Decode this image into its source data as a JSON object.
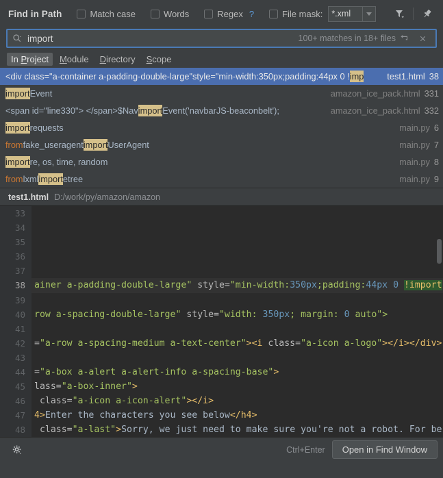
{
  "toolbar": {
    "title": "Find in Path",
    "options": [
      {
        "label": "Match case",
        "checked": false
      },
      {
        "label": "Words",
        "checked": false
      },
      {
        "label": "Regex",
        "checked": false,
        "help": "?"
      },
      {
        "label": "File mask:",
        "checked": false
      }
    ],
    "file_mask_value": "*.xml",
    "filter_icon": "filter-icon",
    "pin_icon": "pin-icon"
  },
  "search": {
    "icon": "search-icon",
    "value": "import",
    "placeholder": "Search",
    "match_info": "100+ matches in 18+ files",
    "history_icon": "history-icon",
    "clear_icon": "close-icon"
  },
  "scopes": {
    "items": [
      {
        "label": "In Project",
        "active": true
      },
      {
        "label": "Module",
        "active": false
      },
      {
        "label": "Directory",
        "active": false
      },
      {
        "label": "Scope",
        "active": false
      }
    ]
  },
  "results": {
    "rows": [
      {
        "selected": true,
        "parts": [
          {
            "t": "<div class=",
            "c": "tag"
          },
          {
            "t": "\"a-container a-padding-double-large\"",
            "c": "str"
          },
          {
            "t": " style=",
            "c": "tag"
          },
          {
            "t": "\"min-width:350px;padding:44px 0 !",
            "c": "str"
          },
          {
            "t": "imp",
            "c": "hl"
          }
        ],
        "file": "test1.html",
        "line": "38"
      },
      {
        "selected": false,
        "parts": [
          {
            "t": "import",
            "c": "hl"
          },
          {
            "t": "Event",
            "c": "def"
          }
        ],
        "file": "amazon_ice_pack.html",
        "line": "331"
      },
      {
        "selected": false,
        "parts": [
          {
            "t": "<span id=\"line330\"> </span>$Nav",
            "c": "def"
          },
          {
            "t": "import",
            "c": "hl"
          },
          {
            "t": "Event('navbarJS-beaconbelt');",
            "c": "def"
          }
        ],
        "file": "amazon_ice_pack.html",
        "line": "332"
      },
      {
        "selected": false,
        "parts": [
          {
            "t": "import",
            "c": "hl"
          },
          {
            "t": " requests",
            "c": "def"
          }
        ],
        "file": "main.py",
        "line": "6"
      },
      {
        "selected": false,
        "parts": [
          {
            "t": "from",
            "c": "kw"
          },
          {
            "t": " fake_useragent ",
            "c": "def"
          },
          {
            "t": "import",
            "c": "hl"
          },
          {
            "t": " UserAgent",
            "c": "def"
          }
        ],
        "file": "main.py",
        "line": "7"
      },
      {
        "selected": false,
        "parts": [
          {
            "t": "import",
            "c": "hl"
          },
          {
            "t": " re, os, time, random",
            "c": "def"
          }
        ],
        "file": "main.py",
        "line": "8"
      },
      {
        "selected": false,
        "parts": [
          {
            "t": "from",
            "c": "kw"
          },
          {
            "t": " lxml ",
            "c": "def"
          },
          {
            "t": "import",
            "c": "hl"
          },
          {
            "t": " etree",
            "c": "def"
          }
        ],
        "file": "main.py",
        "line": "9"
      }
    ]
  },
  "file_header": {
    "name": "test1.html",
    "path": "D:/work/py/amazon/amazon"
  },
  "editor": {
    "browser_bar": {
      "icons": [
        "reformat-icon",
        "chrome-icon",
        "firefox-icon",
        "safari-icon",
        "opera-icon",
        "internet-explorer-icon",
        "edge-icon"
      ]
    },
    "lines": [
      {
        "num": "33",
        "current": false,
        "parts": []
      },
      {
        "num": "34",
        "current": false,
        "parts": []
      },
      {
        "num": "35",
        "current": false,
        "parts": []
      },
      {
        "num": "36",
        "current": false,
        "parts": []
      },
      {
        "num": "37",
        "current": false,
        "parts": []
      },
      {
        "num": "38",
        "current": true,
        "parts": [
          {
            "t": "ainer a-padding-double-large",
            "c": "str"
          },
          {
            "t": "\" ",
            "c": "str"
          },
          {
            "t": "style=",
            "c": "attr"
          },
          {
            "t": "\"min-width:",
            "c": "str"
          },
          {
            "t": "350px",
            "c": "num"
          },
          {
            "t": ";padding:",
            "c": "str"
          },
          {
            "t": "44px",
            "c": "num"
          },
          {
            "t": " ",
            "c": "str"
          },
          {
            "t": "0",
            "c": "num"
          },
          {
            "t": " ",
            "c": "str"
          },
          {
            "t": "!import",
            "c": "green"
          }
        ]
      },
      {
        "num": "39",
        "current": false,
        "parts": []
      },
      {
        "num": "40",
        "current": false,
        "parts": [
          {
            "t": "row a-spacing-double-large",
            "c": "str"
          },
          {
            "t": "\" ",
            "c": "str"
          },
          {
            "t": "style=",
            "c": "attr"
          },
          {
            "t": "\"width: ",
            "c": "str"
          },
          {
            "t": "350px",
            "c": "num"
          },
          {
            "t": "; margin: ",
            "c": "str"
          },
          {
            "t": "0",
            "c": "num"
          },
          {
            "t": " auto\">",
            "c": "str"
          }
        ]
      },
      {
        "num": "41",
        "current": false,
        "parts": []
      },
      {
        "num": "42",
        "current": false,
        "parts": [
          {
            "t": "=",
            "c": "attr"
          },
          {
            "t": "\"a-row a-spacing-medium a-text-center\"",
            "c": "str"
          },
          {
            "t": "><i ",
            "c": "tag"
          },
          {
            "t": "class=",
            "c": "attr"
          },
          {
            "t": "\"a-icon a-logo\"",
            "c": "str"
          },
          {
            "t": "></i></div>",
            "c": "tag"
          }
        ]
      },
      {
        "num": "43",
        "current": false,
        "parts": []
      },
      {
        "num": "44",
        "current": false,
        "parts": [
          {
            "t": "=",
            "c": "attr"
          },
          {
            "t": "\"a-box a-alert a-alert-info a-spacing-base\"",
            "c": "str"
          },
          {
            "t": ">",
            "c": "tag"
          }
        ]
      },
      {
        "num": "45",
        "current": false,
        "parts": [
          {
            "t": "lass=",
            "c": "attr"
          },
          {
            "t": "\"a-box-inner\"",
            "c": "str"
          },
          {
            "t": ">",
            "c": "tag"
          }
        ]
      },
      {
        "num": "46",
        "current": false,
        "parts": [
          {
            "t": " class=",
            "c": "attr"
          },
          {
            "t": "\"a-icon a-icon-alert\"",
            "c": "str"
          },
          {
            "t": "></i>",
            "c": "tag"
          }
        ]
      },
      {
        "num": "47",
        "current": false,
        "parts": [
          {
            "t": "4>",
            "c": "tag"
          },
          {
            "t": "Enter the characters you see below",
            "c": "txt"
          },
          {
            "t": "</h4>",
            "c": "tag"
          }
        ]
      },
      {
        "num": "48",
        "current": false,
        "parts": [
          {
            "t": " class=",
            "c": "attr"
          },
          {
            "t": "\"a-last\"",
            "c": "str"
          },
          {
            "t": ">",
            "c": "tag"
          },
          {
            "t": "Sorry, we just need to make sure you're not a robot. For be",
            "c": "txt"
          }
        ]
      }
    ]
  },
  "bottom": {
    "settings_icon": "gear-icon",
    "shortcut": "Ctrl+Enter",
    "open_button": "Open in Find Window"
  }
}
